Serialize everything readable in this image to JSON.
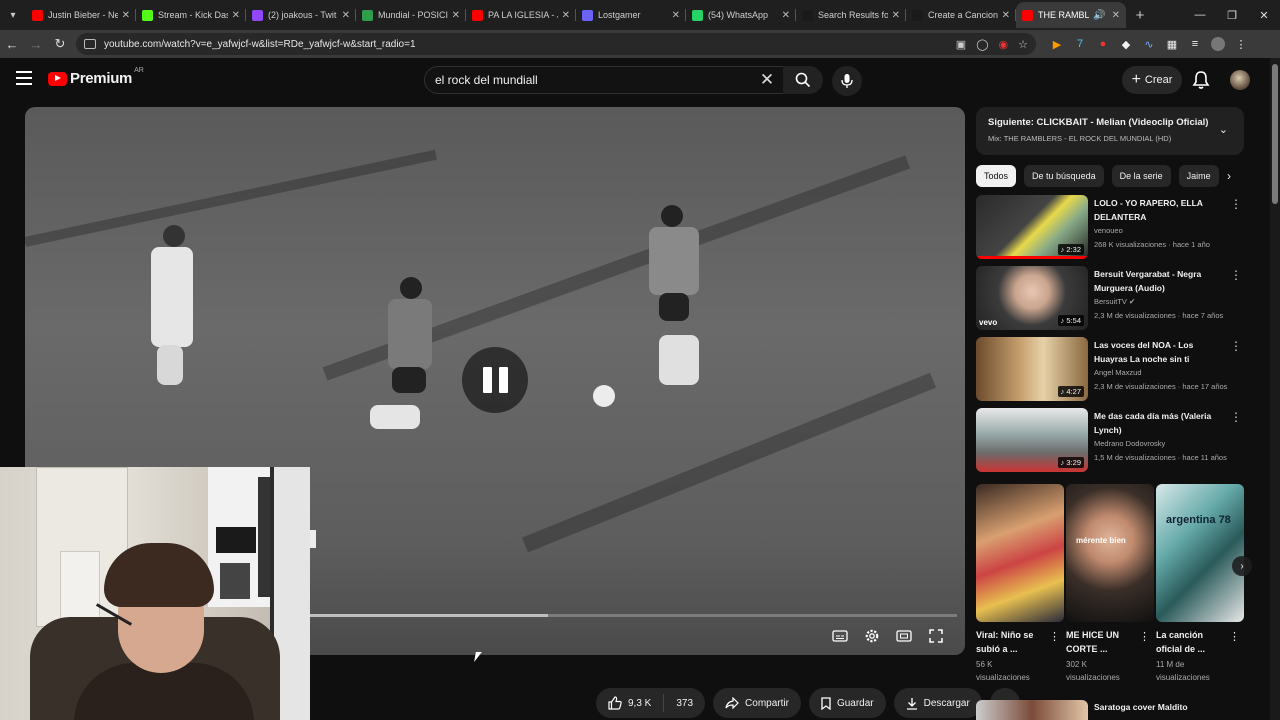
{
  "browser": {
    "tabs": [
      {
        "title": "Justin Bieber - Ne",
        "fav": "#ff0000",
        "active": false
      },
      {
        "title": "Stream - Kick Das",
        "fav": "#53fc18",
        "active": false
      },
      {
        "title": "(2) joakous - Twit",
        "fav": "#9146ff",
        "active": false
      },
      {
        "title": "Mundial - POSICI",
        "fav": "#2e9e4a",
        "active": false
      },
      {
        "title": "PA LA IGLESIA - J",
        "fav": "#ff0000",
        "active": false
      },
      {
        "title": "Lostgamer",
        "fav": "#6c63ff",
        "active": false
      },
      {
        "title": "(54) WhatsApp",
        "fav": "#25d366",
        "active": false
      },
      {
        "title": "Search Results fo",
        "fav": "#1a1a1a",
        "active": false
      },
      {
        "title": "Create a Cancion",
        "fav": "#1a1a1a",
        "active": false
      },
      {
        "title": "THE RAMBLERS",
        "fav": "#ff0000",
        "active": true
      }
    ],
    "url": "youtube.com/watch?v=e_yafwjcf-w&list=RDe_yafwjcf-w&start_radio=1"
  },
  "header": {
    "logo_text": "Premium",
    "country": "AR",
    "search_value": "el rock del mundiall",
    "create_label": "Crear"
  },
  "player": {
    "progress": 0.37
  },
  "actions": {
    "likes": "9,3 K",
    "dislikes": "373",
    "share": "Compartir",
    "save": "Guardar",
    "download": "Descargar"
  },
  "sidebar": {
    "next_title": "Siguiente: CLICKBAIT - Melian (Videoclip Oficial)",
    "next_mix": "Mix: THE RAMBLERS - EL ROCK DEL MUNDIAL (HD)",
    "chips": [
      "Todos",
      "De tu búsqueda",
      "De la serie",
      "Jaime"
    ],
    "recs": [
      {
        "title": "LOLO - YO RAPERO, ELLA DELANTERA",
        "channel": "venoueo",
        "meta": "268 K visualizaciones · hace 1 año",
        "duration": "2:32"
      },
      {
        "title": "Bersuit Vergarabat - Negra Murguera (Audio)",
        "channel": "BersuitTV",
        "meta": "2,3 M de visualizaciones · hace 7 años",
        "duration": "5:54",
        "badge": "vevo"
      },
      {
        "title": "Las voces del NOA - Los Huayras   La noche sin ti",
        "channel": "Angel Maxzud",
        "meta": "2,3 M de visualizaciones · hace 17 años",
        "duration": "4:27"
      },
      {
        "title": "Me das cada día más (Valeria Lynch)",
        "channel": "Medrano Dodovrosky",
        "meta": "1,5 M de visualizaciones · hace 11 años",
        "duration": "3:29"
      }
    ],
    "shorts": [
      {
        "title": "Viral: Niño se subió a ...",
        "views": "56 K visualizaciones"
      },
      {
        "title": "ME HICE UN CORTE ...",
        "views": "302 K visualizaciones",
        "overlay": "mérente bien"
      },
      {
        "title": "La canción oficial de ...",
        "views": "11 M de visualizaciones",
        "overlay": "argentina 78"
      }
    ],
    "bottom_title": "Saratoga  cover  Maldito"
  }
}
